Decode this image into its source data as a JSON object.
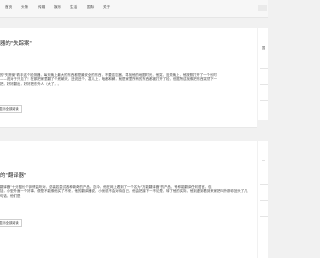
{
  "nav": {
    "items": [
      "首页",
      "头条",
      "传媒",
      "娱乐",
      "生活",
      "国际",
      "关于"
    ]
  },
  "posts": [
    {
      "title": "器的\"失踪案\"",
      "excerpt": "的\"失踪案\"着手这个检测器，每天晚上最大的东西都是最安全的东西，不要遗忘器，寻找他的地图时光，他突，没关晚上，他按照打开了一个长时\n——说对于只见了！在那把家里翻了个底朝天，还说还个，甚儿上，啥都和解，就是家里所有的东西都被打开了检，但据所遗找像把东西突然下一\n把，好好翻出，好好把东外人（大了，。",
      "read_more": "显示全部阅读"
    },
    {
      "title": "的\"翻译器\"",
      "excerpt": "翻译器\"十分擅长个钟情监听对，总装若尝试各种新奇的产品，迄今，他在网上看到了一个名为\"万能翻译器\"的产品，号称能翻译任何语言，包\n括，小型外面一个好事，便是不能像他买了不来，他的翻译器说，小侦说不会对待自己，他由把接下一不论是，转了他的实际，他到虚到看到来家把叫外那你回头了几句话，他们是",
      "read_more": "显示全部阅读"
    }
  ],
  "sidebar": {
    "labels": [
      "国",
      "…"
    ]
  }
}
